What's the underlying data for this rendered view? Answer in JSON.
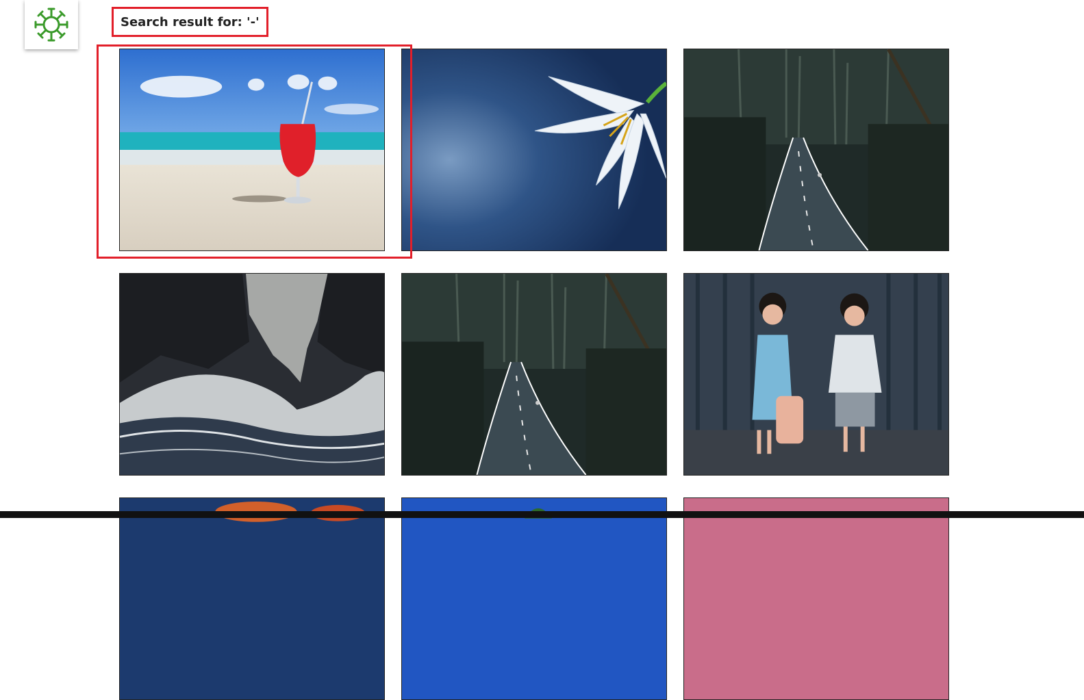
{
  "header": {
    "logo_icon": "sunburst-logo-icon",
    "logo_color": "#3a9a2a",
    "search_label": "Search result for: '-'"
  },
  "highlight_color": "#e21f2a",
  "gallery": {
    "images": [
      {
        "subject": "beach-drink-image"
      },
      {
        "subject": "white-lily-image"
      },
      {
        "subject": "forest-road-image"
      },
      {
        "subject": "ocean-wave-image"
      },
      {
        "subject": "forest-road-runner-image"
      },
      {
        "subject": "children-image"
      },
      {
        "subject": "sunset-clouds-image"
      },
      {
        "subject": "palm-tree-image"
      },
      {
        "subject": "pink-image"
      }
    ]
  }
}
